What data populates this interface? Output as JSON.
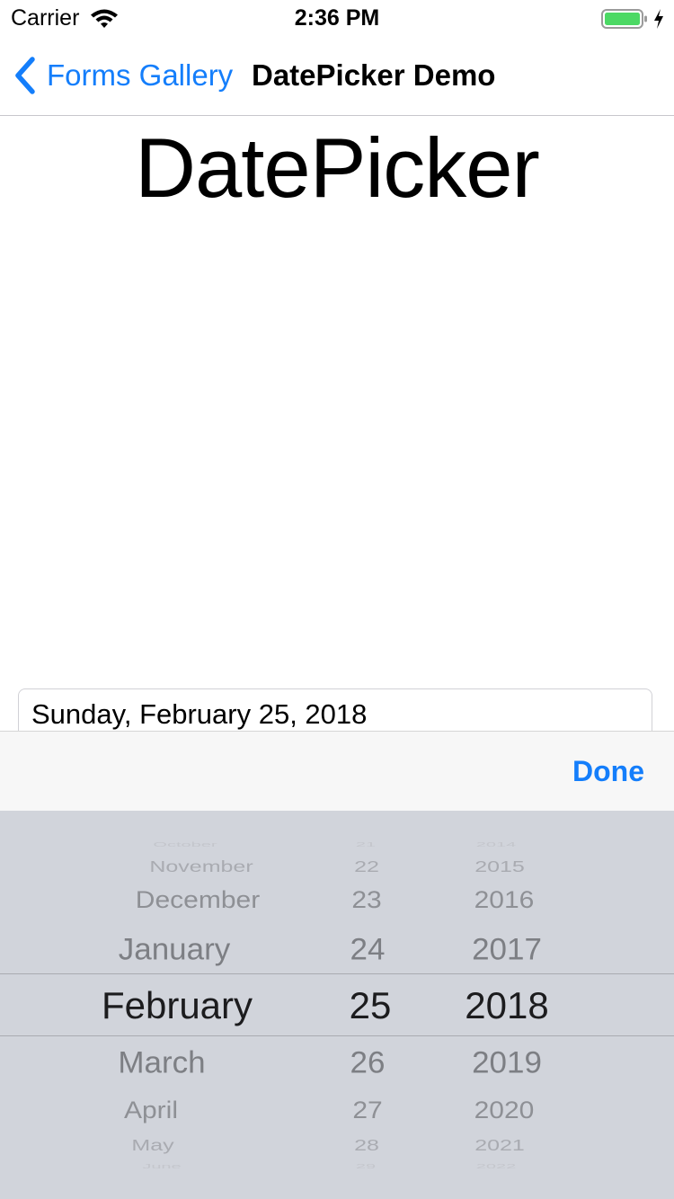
{
  "status_bar": {
    "carrier": "Carrier",
    "time": "2:36 PM",
    "battery_color": "#4cd964"
  },
  "nav": {
    "back_label": "Forms Gallery",
    "title": "DatePicker Demo",
    "back_icon": "chevron-left-icon"
  },
  "page": {
    "title": "DatePicker"
  },
  "date_field": {
    "value": "Sunday, February 25, 2018"
  },
  "toolbar": {
    "done_label": "Done"
  },
  "picker": {
    "months": [
      "October",
      "November",
      "December",
      "January",
      "February",
      "March",
      "April",
      "May",
      "June"
    ],
    "days": [
      "21",
      "22",
      "23",
      "24",
      "25",
      "26",
      "27",
      "28",
      "29"
    ],
    "years": [
      "2014",
      "2015",
      "2016",
      "2017",
      "2018",
      "2019",
      "2020",
      "2021",
      "2022"
    ],
    "selected": {
      "month": "February",
      "day": "25",
      "year": "2018"
    }
  },
  "colors": {
    "accent": "#147efb",
    "picker_bg": "#d1d4db",
    "toolbar_bg": "#f7f7f7"
  }
}
